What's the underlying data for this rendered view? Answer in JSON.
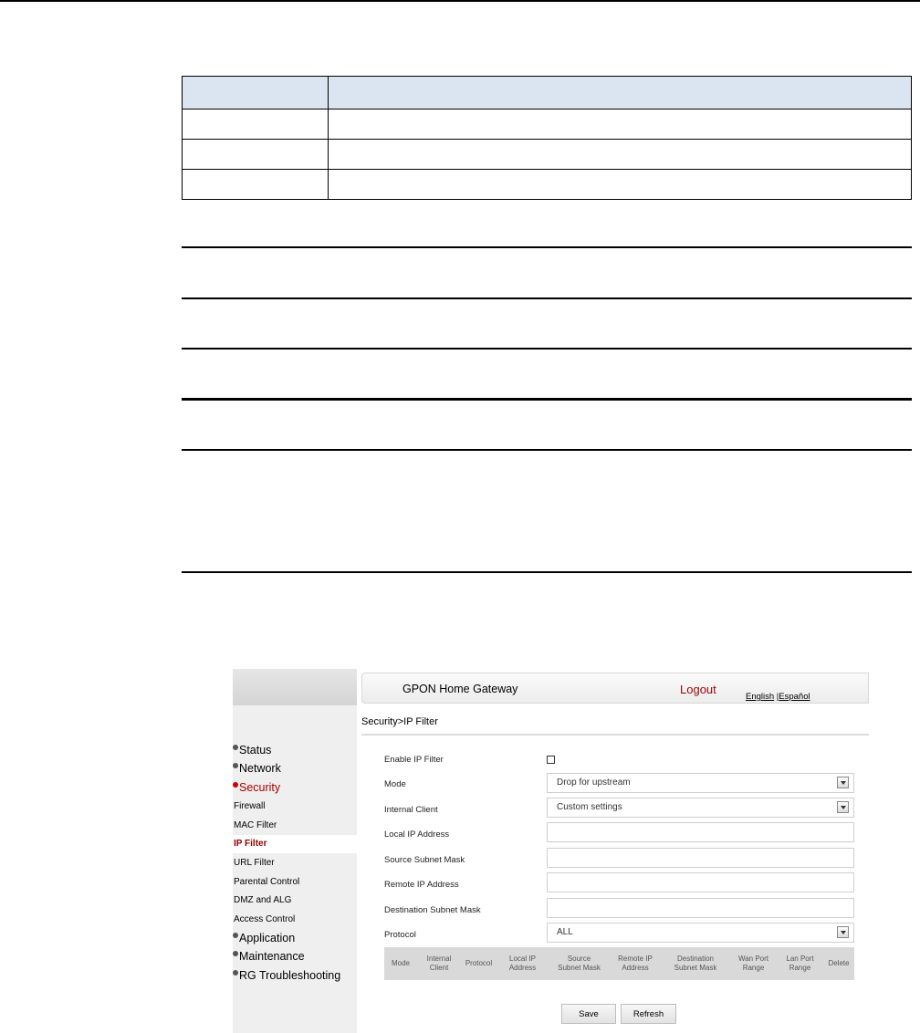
{
  "document": {
    "table": {
      "rows": 4
    }
  },
  "screenshot": {
    "header": {
      "title": "GPON Home Gateway",
      "logout": "Logout",
      "lang_english": "English",
      "lang_separator": " |",
      "lang_espanol": "Español"
    },
    "breadcrumb": "Security>IP Filter",
    "sidebar": {
      "menus": [
        {
          "label": "Status",
          "active": false
        },
        {
          "label": "Network",
          "active": false
        },
        {
          "label": "Security",
          "active": true
        },
        {
          "label": "Application",
          "active": false
        },
        {
          "label": "Maintenance",
          "active": false
        },
        {
          "label": "RG Troubleshooting",
          "active": false
        }
      ],
      "submenu": [
        "Firewall",
        "MAC Filter",
        "IP Filter",
        "URL Filter",
        "Parental Control",
        "DMZ and ALG",
        "Access Control"
      ],
      "selected_submenu": "IP Filter"
    },
    "form": {
      "enable_label": "Enable IP Filter",
      "enable_checked": false,
      "mode_label": "Mode",
      "mode_value": "Drop for upstream",
      "internal_client_label": "Internal Client",
      "internal_client_value": "Custom settings",
      "local_ip_label": "Local IP Address",
      "source_mask_label": "Source Subnet Mask",
      "remote_ip_label": "Remote IP Address",
      "dest_mask_label": "Destination Subnet Mask",
      "protocol_label": "Protocol",
      "protocol_value": "ALL"
    },
    "list_columns": [
      [
        "Mode"
      ],
      [
        "Internal",
        "Client"
      ],
      [
        "Protocol"
      ],
      [
        "Local IP",
        "Address"
      ],
      [
        "Source",
        "Subnet Mask"
      ],
      [
        "Remote IP",
        "Address"
      ],
      [
        "Destination",
        "Subnet Mask"
      ],
      [
        "Wan Port",
        "Range"
      ],
      [
        "Lan Port",
        "Range"
      ],
      [
        "Delete"
      ]
    ],
    "buttons": {
      "save": "Save",
      "refresh": "Refresh"
    }
  }
}
